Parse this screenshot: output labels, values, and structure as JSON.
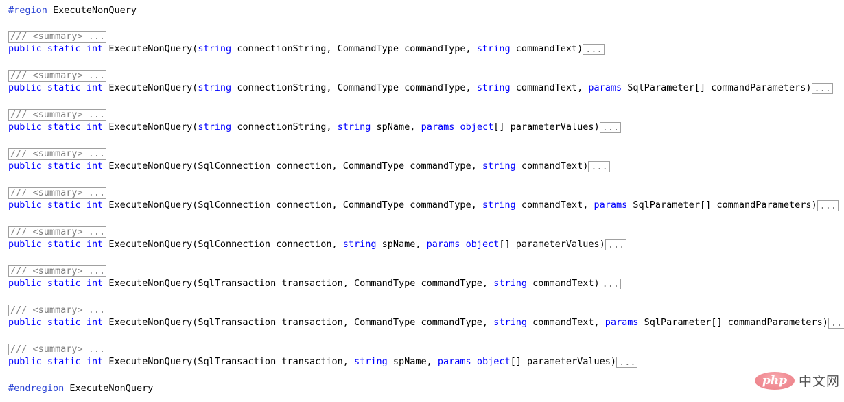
{
  "editor": {
    "language": "csharp",
    "background_color": "#ffffff",
    "text_color": "#000000",
    "keyword_color": "#0000ff",
    "preprocessor_color": "#2b44d4",
    "collapsed_color": "#808080",
    "collapsed_border_color": "#a0a0a0",
    "region_start": {
      "directive": "#region",
      "name": "ExecuteNonQuery"
    },
    "region_end": {
      "directive": "#endregion",
      "name": "ExecuteNonQuery"
    },
    "collapsed_summary_text": "/// <summary> ...",
    "collapsed_body_text": "...",
    "methods": [
      {
        "summary": "/// <summary> ...",
        "tokens": [
          {
            "t": "public",
            "k": "kw"
          },
          {
            "t": " ",
            "k": "plain"
          },
          {
            "t": "static",
            "k": "kw"
          },
          {
            "t": " ",
            "k": "plain"
          },
          {
            "t": "int",
            "k": "kw"
          },
          {
            "t": " ExecuteNonQuery(",
            "k": "plain"
          },
          {
            "t": "string",
            "k": "kw"
          },
          {
            "t": " connectionString, CommandType commandType, ",
            "k": "plain"
          },
          {
            "t": "string",
            "k": "kw"
          },
          {
            "t": " commandText)",
            "k": "plain"
          }
        ],
        "body": "..."
      },
      {
        "summary": "/// <summary> ...",
        "tokens": [
          {
            "t": "public",
            "k": "kw"
          },
          {
            "t": " ",
            "k": "plain"
          },
          {
            "t": "static",
            "k": "kw"
          },
          {
            "t": " ",
            "k": "plain"
          },
          {
            "t": "int",
            "k": "kw"
          },
          {
            "t": " ExecuteNonQuery(",
            "k": "plain"
          },
          {
            "t": "string",
            "k": "kw"
          },
          {
            "t": " connectionString, CommandType commandType, ",
            "k": "plain"
          },
          {
            "t": "string",
            "k": "kw"
          },
          {
            "t": " commandText, ",
            "k": "plain"
          },
          {
            "t": "params",
            "k": "kw"
          },
          {
            "t": " SqlParameter[] commandParameters)",
            "k": "plain"
          }
        ],
        "body": "..."
      },
      {
        "summary": "/// <summary> ...",
        "tokens": [
          {
            "t": "public",
            "k": "kw"
          },
          {
            "t": " ",
            "k": "plain"
          },
          {
            "t": "static",
            "k": "kw"
          },
          {
            "t": " ",
            "k": "plain"
          },
          {
            "t": "int",
            "k": "kw"
          },
          {
            "t": " ExecuteNonQuery(",
            "k": "plain"
          },
          {
            "t": "string",
            "k": "kw"
          },
          {
            "t": " connectionString, ",
            "k": "plain"
          },
          {
            "t": "string",
            "k": "kw"
          },
          {
            "t": " spName, ",
            "k": "plain"
          },
          {
            "t": "params",
            "k": "kw"
          },
          {
            "t": " ",
            "k": "plain"
          },
          {
            "t": "object",
            "k": "kw"
          },
          {
            "t": "[] parameterValues)",
            "k": "plain"
          }
        ],
        "body": "..."
      },
      {
        "summary": "/// <summary> ...",
        "tokens": [
          {
            "t": "public",
            "k": "kw"
          },
          {
            "t": " ",
            "k": "plain"
          },
          {
            "t": "static",
            "k": "kw"
          },
          {
            "t": " ",
            "k": "plain"
          },
          {
            "t": "int",
            "k": "kw"
          },
          {
            "t": " ExecuteNonQuery(SqlConnection connection, CommandType commandType, ",
            "k": "plain"
          },
          {
            "t": "string",
            "k": "kw"
          },
          {
            "t": " commandText)",
            "k": "plain"
          }
        ],
        "body": "..."
      },
      {
        "summary": "/// <summary> ...",
        "tokens": [
          {
            "t": "public",
            "k": "kw"
          },
          {
            "t": " ",
            "k": "plain"
          },
          {
            "t": "static",
            "k": "kw"
          },
          {
            "t": " ",
            "k": "plain"
          },
          {
            "t": "int",
            "k": "kw"
          },
          {
            "t": " ExecuteNonQuery(SqlConnection connection, CommandType commandType, ",
            "k": "plain"
          },
          {
            "t": "string",
            "k": "kw"
          },
          {
            "t": " commandText, ",
            "k": "plain"
          },
          {
            "t": "params",
            "k": "kw"
          },
          {
            "t": " SqlParameter[] commandParameters)",
            "k": "plain"
          }
        ],
        "body": "..."
      },
      {
        "summary": "/// <summary> ...",
        "tokens": [
          {
            "t": "public",
            "k": "kw"
          },
          {
            "t": " ",
            "k": "plain"
          },
          {
            "t": "static",
            "k": "kw"
          },
          {
            "t": " ",
            "k": "plain"
          },
          {
            "t": "int",
            "k": "kw"
          },
          {
            "t": " ExecuteNonQuery(SqlConnection connection, ",
            "k": "plain"
          },
          {
            "t": "string",
            "k": "kw"
          },
          {
            "t": " spName, ",
            "k": "plain"
          },
          {
            "t": "params",
            "k": "kw"
          },
          {
            "t": " ",
            "k": "plain"
          },
          {
            "t": "object",
            "k": "kw"
          },
          {
            "t": "[] parameterValues)",
            "k": "plain"
          }
        ],
        "body": "..."
      },
      {
        "summary": "/// <summary> ...",
        "tokens": [
          {
            "t": "public",
            "k": "kw"
          },
          {
            "t": " ",
            "k": "plain"
          },
          {
            "t": "static",
            "k": "kw"
          },
          {
            "t": " ",
            "k": "plain"
          },
          {
            "t": "int",
            "k": "kw"
          },
          {
            "t": " ExecuteNonQuery(SqlTransaction transaction, CommandType commandType, ",
            "k": "plain"
          },
          {
            "t": "string",
            "k": "kw"
          },
          {
            "t": " commandText)",
            "k": "plain"
          }
        ],
        "body": "..."
      },
      {
        "summary": "/// <summary> ...",
        "tokens": [
          {
            "t": "public",
            "k": "kw"
          },
          {
            "t": " ",
            "k": "plain"
          },
          {
            "t": "static",
            "k": "kw"
          },
          {
            "t": " ",
            "k": "plain"
          },
          {
            "t": "int",
            "k": "kw"
          },
          {
            "t": " ExecuteNonQuery(SqlTransaction transaction, CommandType commandType, ",
            "k": "plain"
          },
          {
            "t": "string",
            "k": "kw"
          },
          {
            "t": " commandText, ",
            "k": "plain"
          },
          {
            "t": "params",
            "k": "kw"
          },
          {
            "t": " SqlParameter[] commandParameters)",
            "k": "plain"
          }
        ],
        "body": "..."
      },
      {
        "summary": "/// <summary> ...",
        "tokens": [
          {
            "t": "public",
            "k": "kw"
          },
          {
            "t": " ",
            "k": "plain"
          },
          {
            "t": "static",
            "k": "kw"
          },
          {
            "t": " ",
            "k": "plain"
          },
          {
            "t": "int",
            "k": "kw"
          },
          {
            "t": " ExecuteNonQuery(SqlTransaction transaction, ",
            "k": "plain"
          },
          {
            "t": "string",
            "k": "kw"
          },
          {
            "t": " spName, ",
            "k": "plain"
          },
          {
            "t": "params",
            "k": "kw"
          },
          {
            "t": " ",
            "k": "plain"
          },
          {
            "t": "object",
            "k": "kw"
          },
          {
            "t": "[] parameterValues)",
            "k": "plain"
          }
        ],
        "body": "..."
      }
    ]
  },
  "watermark": {
    "logo_text": "php",
    "site_text": "中文网",
    "badge_color": "#ee8088",
    "site_text_color": "#4a4a4a"
  }
}
